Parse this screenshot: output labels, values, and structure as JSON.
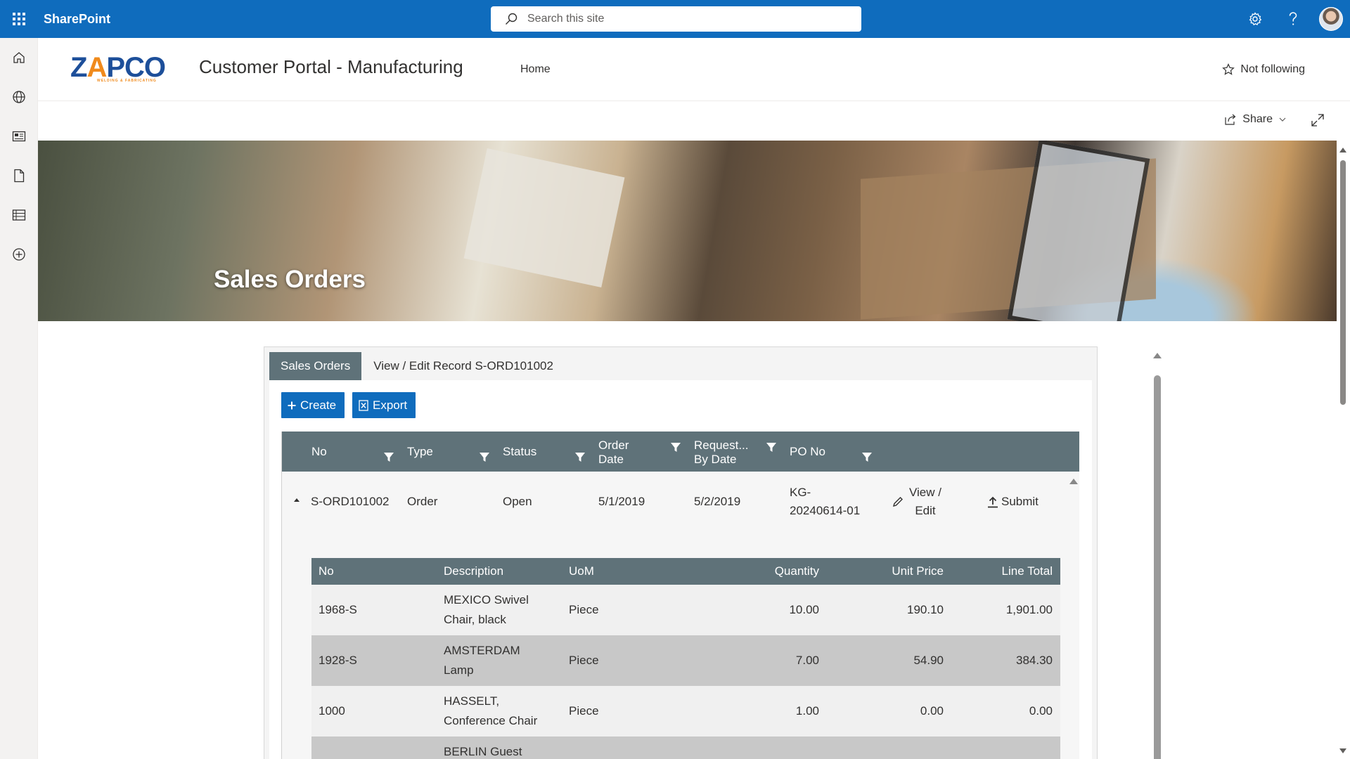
{
  "suite": {
    "app_name": "SharePoint",
    "search_placeholder": "Search this site",
    "icons": [
      "waffle-icon",
      "settings-icon",
      "help-icon",
      "avatar"
    ]
  },
  "left_rail": {
    "items": [
      "home-icon",
      "globe-icon",
      "news-icon",
      "document-icon",
      "list-icon",
      "add-circle-icon"
    ]
  },
  "site": {
    "logo_text": "ZAPCO",
    "logo_subtext": "WELDING & FABRICATING",
    "title": "Customer Portal - Manufacturing",
    "nav_home": "Home",
    "follow_label": "Not following"
  },
  "command_bar": {
    "share_label": "Share"
  },
  "banner": {
    "title": "Sales Orders"
  },
  "app": {
    "tab_active": "Sales Orders",
    "breadcrumb": "View / Edit Record S-ORD101002",
    "create_label": "Create",
    "export_label": "Export",
    "columns": {
      "no": "No",
      "type": "Type",
      "status": "Status",
      "order_date_l1": "Order",
      "order_date_l2": "Date",
      "request_l1": "Request...",
      "request_l2": "By Date",
      "po_no": "PO No"
    },
    "order": {
      "no": "S-ORD101002",
      "type": "Order",
      "status": "Open",
      "order_date": "5/1/2019",
      "request_date": "5/2/2019",
      "po_l1": "KG-",
      "po_l2": "20240614-01",
      "view_edit_l1": "View /",
      "view_edit_l2": "Edit",
      "submit_label": "Submit"
    },
    "lines_columns": {
      "no": "No",
      "description": "Description",
      "uom": "UoM",
      "quantity": "Quantity",
      "unit_price": "Unit Price",
      "line_total": "Line Total"
    },
    "lines": [
      {
        "no": "1968-S",
        "desc_l1": "MEXICO Swivel",
        "desc_l2": "Chair, black",
        "uom": "Piece",
        "quantity": "10.00",
        "unit_price": "190.10",
        "line_total": "1,901.00"
      },
      {
        "no": "1928-S",
        "desc_l1": "AMSTERDAM",
        "desc_l2": "Lamp",
        "uom": "Piece",
        "quantity": "7.00",
        "unit_price": "54.90",
        "line_total": "384.30"
      },
      {
        "no": "1000",
        "desc_l1": "HASSELT,",
        "desc_l2": "Conference Chair",
        "uom": "Piece",
        "quantity": "1.00",
        "unit_price": "0.00",
        "line_total": "0.00"
      },
      {
        "no": "",
        "desc_l1": "BERLIN Guest",
        "desc_l2": "",
        "uom": "",
        "quantity": "",
        "unit_price": "",
        "line_total": ""
      }
    ]
  },
  "colors": {
    "suite_bar": "#0f6cbd",
    "grid_header": "#5f7279",
    "button": "#0f6cbd"
  }
}
